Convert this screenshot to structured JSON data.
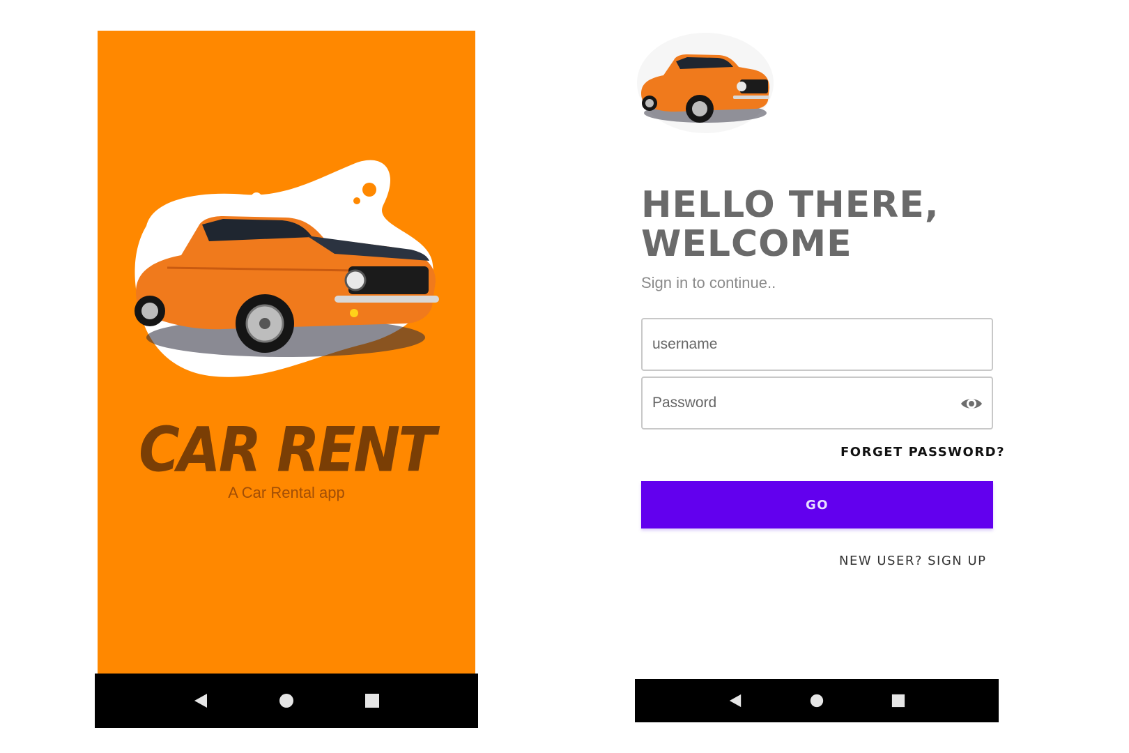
{
  "splash": {
    "title": "CAR RENT",
    "subtitle": "A Car Rental app",
    "background_color": "#ff8800",
    "title_color": "#7a3e05"
  },
  "login": {
    "title_line1": "HELLO THERE,",
    "title_line2": "WELCOME",
    "subtitle": "Sign in to continue..",
    "username_placeholder": "username",
    "password_placeholder": "Password",
    "forget_password_label": "FORGET PASSWORD?",
    "go_label": "GO",
    "signup_label": "NEW USER? SIGN UP",
    "accent_color": "#6200ee"
  },
  "navbar": {
    "icons": [
      "back-icon",
      "home-icon",
      "recents-icon"
    ]
  }
}
